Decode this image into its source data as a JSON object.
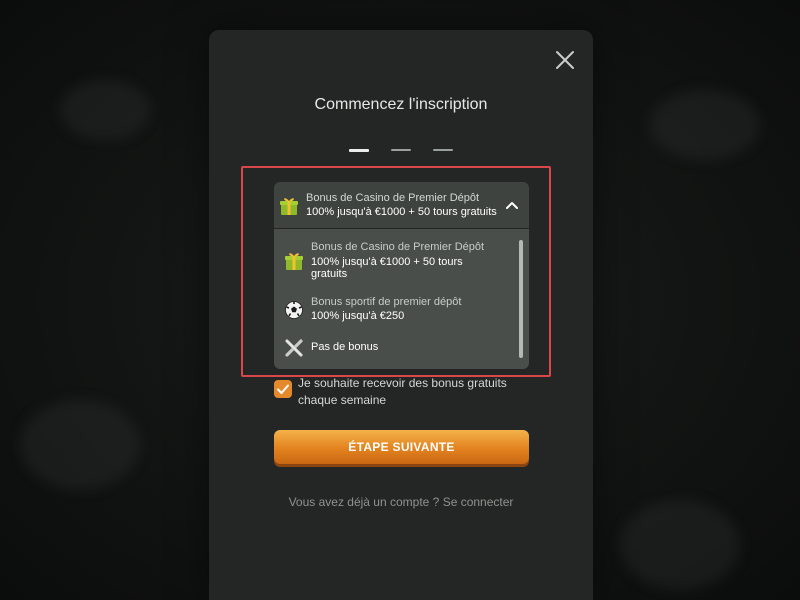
{
  "modal": {
    "title": "Commencez l'inscription",
    "steps": [
      {
        "active": true
      },
      {
        "active": false
      },
      {
        "active": false
      }
    ]
  },
  "bonus_dropdown": {
    "selected": {
      "icon": "gift-icon",
      "label": "Bonus de Casino de Premier Dépôt",
      "value": "100% jusqu'à €1000 + 50 tours gratuits"
    },
    "options": [
      {
        "icon": "gift-icon",
        "label": "Bonus de Casino de Premier Dépôt",
        "value": "100% jusqu'à €1000 + 50 tours gratuits"
      },
      {
        "icon": "soccer-ball-icon",
        "label": "Bonus sportif de premier dépôt",
        "value": "100% jusqu'à €250"
      },
      {
        "icon": "no-bonus-x-icon",
        "label": "Pas de bonus"
      }
    ]
  },
  "consent": {
    "checked": true,
    "text": "Je souhaite recevoir des bonus gratuits chaque semaine"
  },
  "next_button": {
    "label": "ÉTAPE SUIVANTE"
  },
  "footer": {
    "text": "Vous avez déjà un compte ? ",
    "link": "Se connecter"
  },
  "colors": {
    "accent": "#e5892d",
    "highlight": "#d9474b"
  }
}
